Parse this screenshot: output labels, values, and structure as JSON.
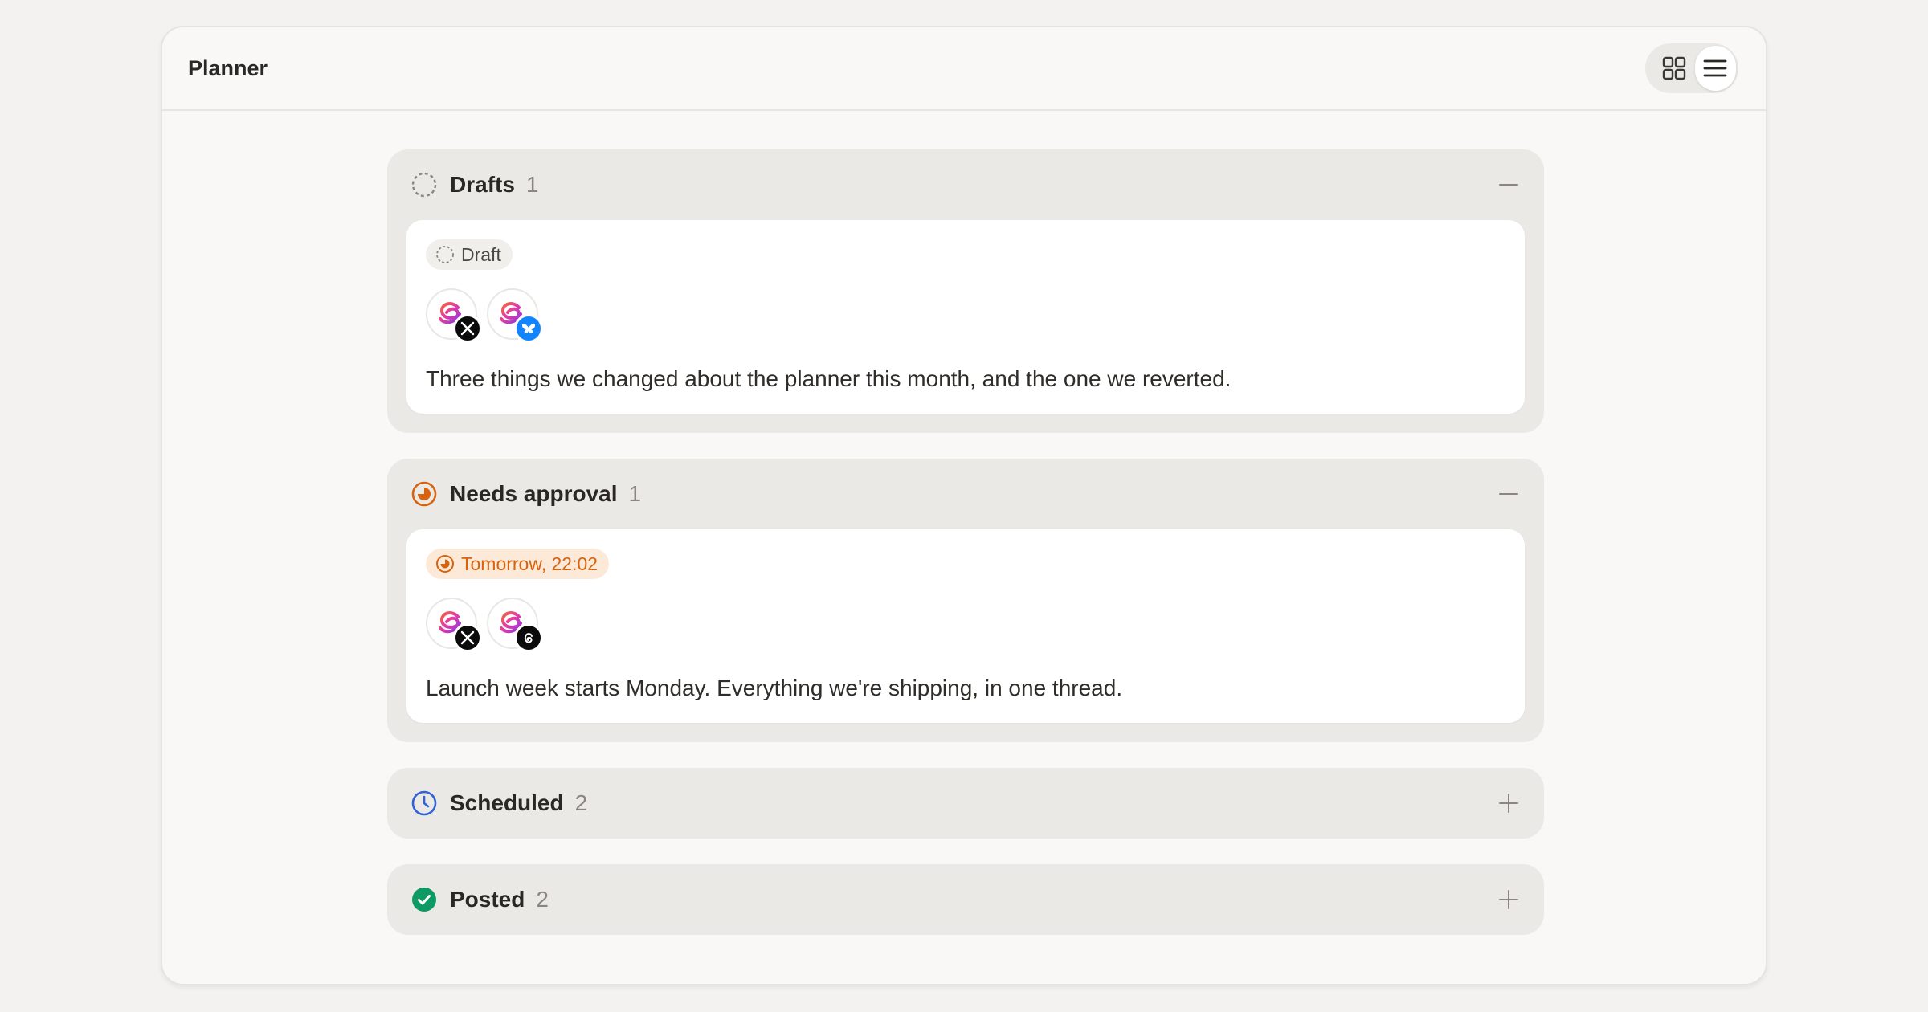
{
  "header": {
    "title": "Planner"
  },
  "sections": [
    {
      "title": "Drafts",
      "count": "1",
      "expanded": true,
      "card": {
        "status_label": "Draft",
        "platforms": [
          "x-icon",
          "bluesky-icon"
        ],
        "text": "Three things we changed about the planner this month, and the one we reverted."
      }
    },
    {
      "title": "Needs approval",
      "count": "1",
      "expanded": true,
      "card": {
        "status_label": "Tomorrow, 22:02",
        "platforms": [
          "x-icon",
          "threads-icon"
        ],
        "text": "Launch week starts Monday. Everything we're shipping, in one thread."
      }
    },
    {
      "title": "Scheduled",
      "count": "2",
      "expanded": false
    },
    {
      "title": "Posted",
      "count": "2",
      "expanded": false
    }
  ],
  "colors": {
    "approval_accent": "#d9620f",
    "scheduled_accent": "#2f63d6",
    "posted_accent": "#0e9a63",
    "bluesky": "#1185fe"
  }
}
